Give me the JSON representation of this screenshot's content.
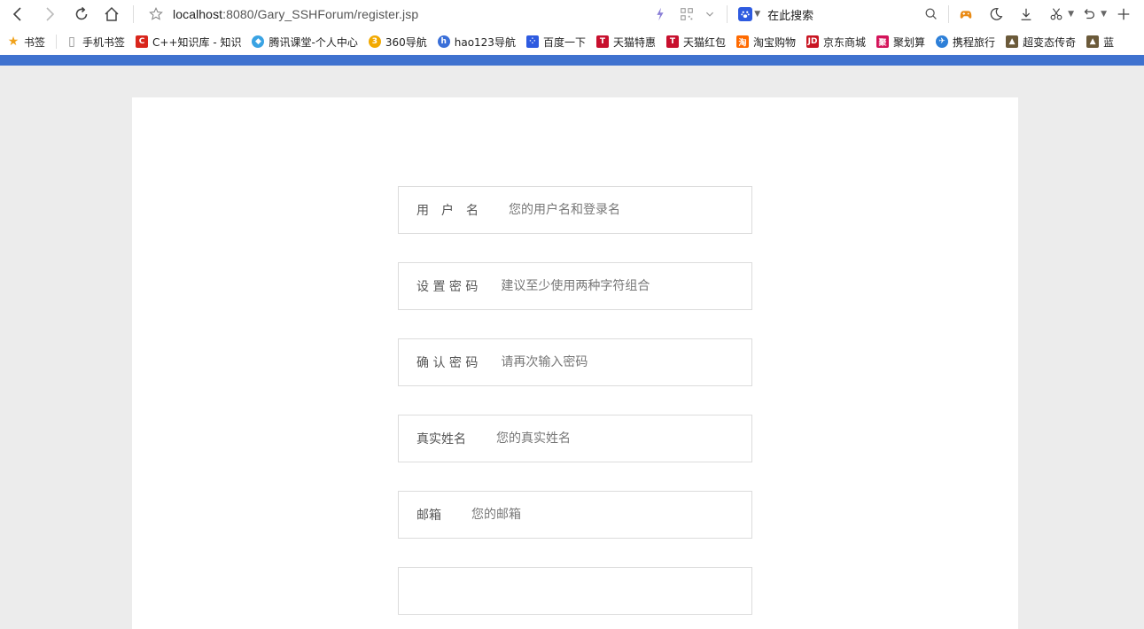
{
  "toolbar": {
    "url_host": "localhost",
    "url_path": ":8080/Gary_SSHForum/register.jsp",
    "search_label": "在此搜索"
  },
  "bookmarks": [
    {
      "label": "书签",
      "icon": "star-icon",
      "color": "#f0a21b"
    },
    {
      "label": "手机书签",
      "icon": "phone-icon",
      "color": "#888888"
    },
    {
      "label": "C++知识库 - 知识",
      "icon": "c-icon",
      "color": "#d9261c"
    },
    {
      "label": "腾讯课堂-个人中心",
      "icon": "diamond-icon",
      "color": "#3aa3e3"
    },
    {
      "label": "360导航",
      "icon": "360-icon",
      "color": "#f2a900"
    },
    {
      "label": "hao123导航",
      "icon": "hao123-icon",
      "color": "#3a6fd8"
    },
    {
      "label": "百度一下",
      "icon": "baidu-paw-icon",
      "color": "#2e5be0"
    },
    {
      "label": "天猫特惠",
      "icon": "tmall-icon",
      "color": "#c8102e"
    },
    {
      "label": "天猫红包",
      "icon": "tmall-icon",
      "color": "#c8102e"
    },
    {
      "label": "淘宝购物",
      "icon": "taobao-icon",
      "color": "#ff6a00"
    },
    {
      "label": "京东商城",
      "icon": "jd-icon",
      "color": "#c91623"
    },
    {
      "label": "聚划算",
      "icon": "juhuasuan-icon",
      "color": "#d4145a"
    },
    {
      "label": "携程旅行",
      "icon": "ctrip-icon",
      "color": "#2d7fd8"
    },
    {
      "label": "超变态传奇",
      "icon": "game-icon",
      "color": "#6b5a3a"
    },
    {
      "label": "蓝",
      "icon": "game-icon",
      "color": "#6b5a3a"
    }
  ],
  "form": {
    "fields": [
      {
        "label": "用　户　名",
        "placeholder": "您的用户名和登录名"
      },
      {
        "label": "设 置 密 码",
        "placeholder": "建议至少使用两种字符组合"
      },
      {
        "label": "确 认 密 码",
        "placeholder": "请再次输入密码"
      },
      {
        "label": "真实姓名",
        "placeholder": "您的真实姓名"
      },
      {
        "label": "邮箱",
        "placeholder": "您的邮箱"
      }
    ]
  },
  "colors": {
    "accent_bar": "#3f72cf",
    "page_bg": "#ececec",
    "field_border": "#dcdcdc"
  }
}
